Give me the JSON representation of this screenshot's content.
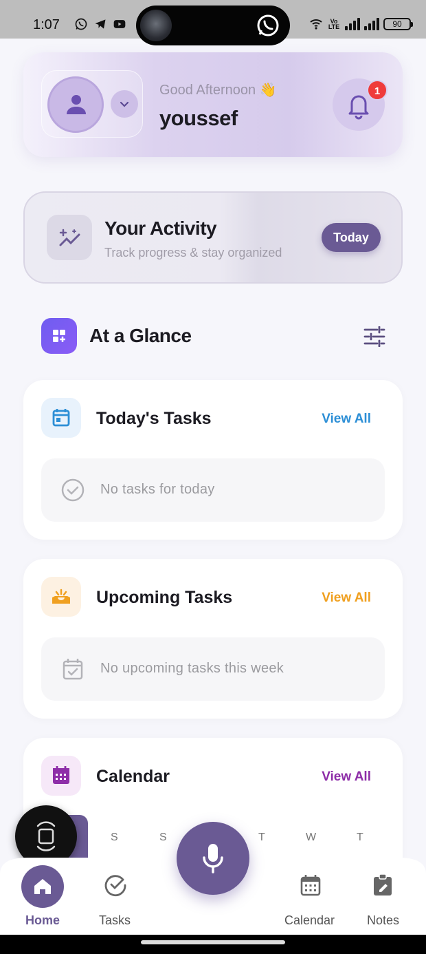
{
  "status_bar": {
    "time": "1:07",
    "battery": "90",
    "network_label": "Vo LTE"
  },
  "header": {
    "greeting": "Good Afternoon 👋",
    "username": "youssef",
    "notification_count": "1"
  },
  "activity": {
    "title": "Your Activity",
    "subtitle": "Track progress & stay organized",
    "period_button": "Today"
  },
  "glance": {
    "title": "At a Glance"
  },
  "today_tasks": {
    "title": "Today's Tasks",
    "view_all": "View All",
    "empty_text": "No tasks for today",
    "accent": "#2d8fd6"
  },
  "upcoming_tasks": {
    "title": "Upcoming Tasks",
    "view_all": "View All",
    "empty_text": "No upcoming tasks this week",
    "accent": "#f0a020"
  },
  "calendar": {
    "title": "Calendar",
    "view_all": "View All",
    "accent": "#8e2ea8",
    "weekdays": [
      "S",
      "S",
      "T",
      "W",
      "T"
    ]
  },
  "bottom_nav": {
    "items": [
      {
        "label": "Home",
        "icon": "home-icon",
        "active": true
      },
      {
        "label": "Tasks",
        "icon": "check-circle-icon",
        "active": false
      },
      {
        "label": "Calendar",
        "icon": "calendar-icon",
        "active": false
      },
      {
        "label": "Notes",
        "icon": "note-icon",
        "active": false
      }
    ],
    "mic_icon": "microphone-icon"
  },
  "colors": {
    "primary": "#6a5a94",
    "badge": "#ef3b3b"
  }
}
